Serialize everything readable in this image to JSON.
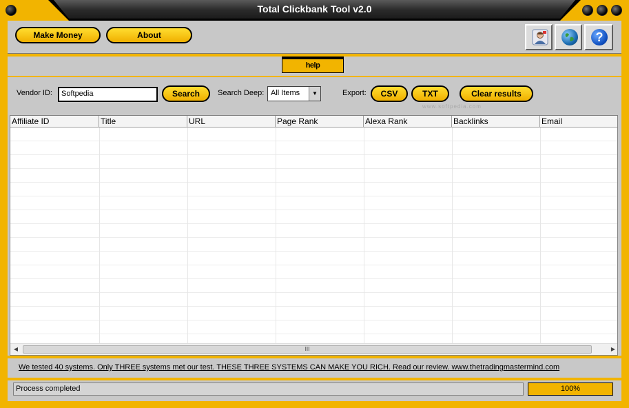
{
  "window": {
    "title": "Total Clickbank Tool v2.0"
  },
  "toolbar": {
    "make_money": "Make Money",
    "about": "About",
    "icons": [
      "contact-icon",
      "globe-icon",
      "help-icon"
    ],
    "help_glyph": "?"
  },
  "help_label": "help",
  "search": {
    "vendor_label": "Vendor ID:",
    "vendor_value": "Softpedia",
    "search_button": "Search",
    "deep_label": "Search Deep:",
    "deep_value": "All Items",
    "export_label": "Export:",
    "csv": "CSV",
    "txt": "TXT",
    "clear": "Clear results"
  },
  "watermark": "www.softpedia.com",
  "table": {
    "columns": [
      "Affiliate ID",
      "Title",
      "URL",
      "Page Rank",
      "Alexa Rank",
      "Backlinks",
      "Email"
    ],
    "rows": [],
    "scroll_grip": "III"
  },
  "promo": "We tested 40 systems. Only THREE systems met our test. THESE THREE SYSTEMS CAN MAKE YOU RICH. Read our review. www.thetradingmastermind.com",
  "status": {
    "text": "Process completed",
    "progress_label": "100%",
    "progress_fraction": 1.0
  },
  "colors": {
    "accent": "#f2b400",
    "panel": "#c8c8c8"
  }
}
